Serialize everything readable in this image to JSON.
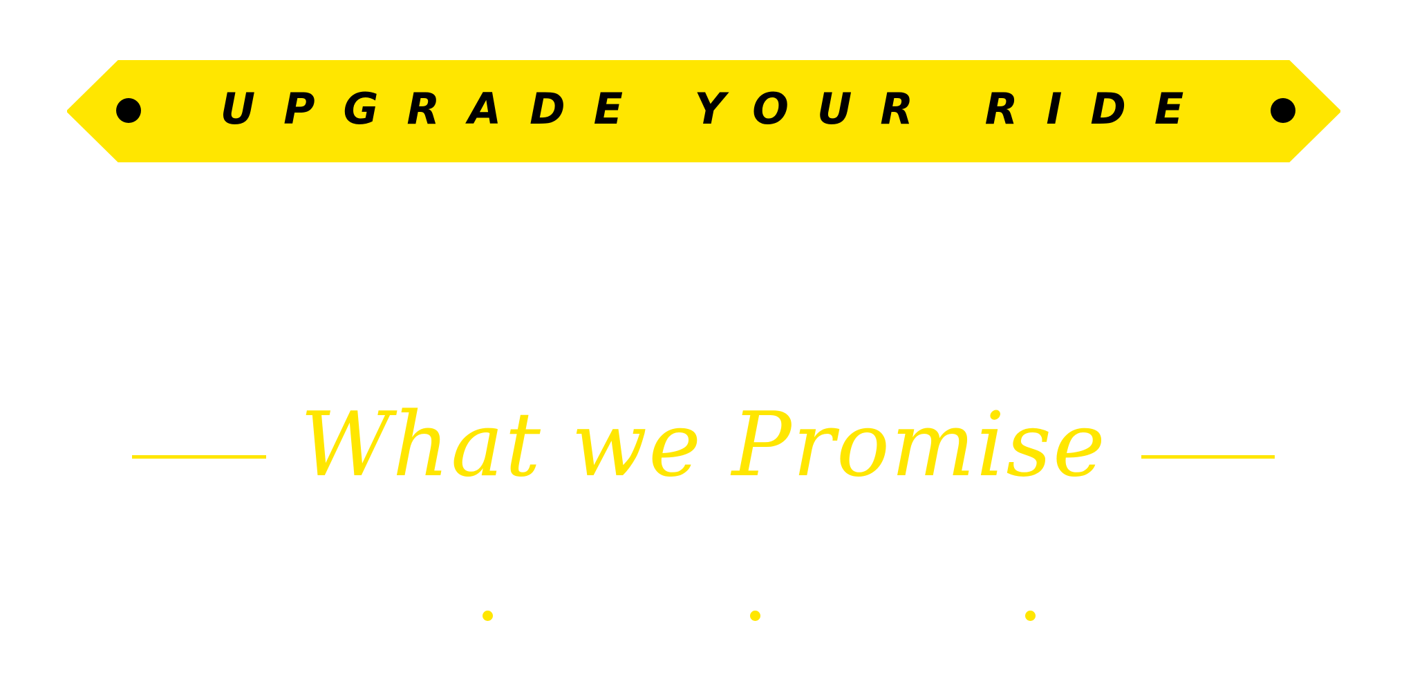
{
  "banner": {
    "text": "UPGRADE YOUR RIDE"
  },
  "section": {
    "title": "What we Promise"
  },
  "colors": {
    "accent": "#FFE600",
    "dark": "#000000",
    "background": "#ffffff"
  }
}
